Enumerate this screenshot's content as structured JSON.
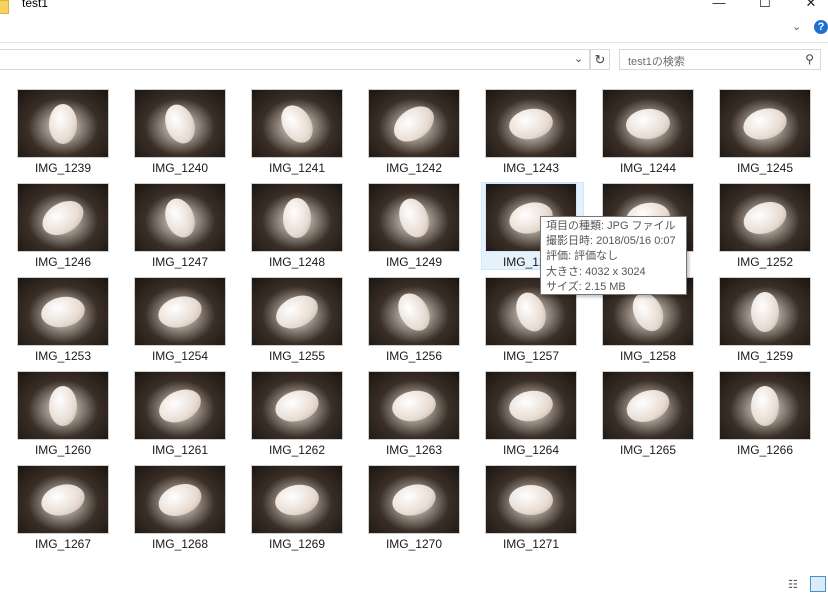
{
  "window": {
    "title": "test1",
    "minimize_glyph": "—",
    "maximize_glyph": "☐",
    "close_glyph": "✕"
  },
  "ribbon": {
    "expand_glyph": "⌄",
    "help_glyph": "?"
  },
  "address": {
    "dropdown_glyph": "⌄",
    "refresh_glyph": "↻"
  },
  "search": {
    "placeholder": "test1の検索",
    "icon": "search-icon",
    "icon_glyph": "⚲"
  },
  "files": [
    "IMG_1239",
    "IMG_1240",
    "IMG_1241",
    "IMG_1242",
    "IMG_1243",
    "IMG_1244",
    "IMG_1245",
    "IMG_1246",
    "IMG_1247",
    "IMG_1248",
    "IMG_1249",
    "IMG_1250",
    "IMG_1251",
    "IMG_1252",
    "IMG_1253",
    "IMG_1254",
    "IMG_1255",
    "IMG_1256",
    "IMG_1257",
    "IMG_1258",
    "IMG_1259",
    "IMG_1260",
    "IMG_1261",
    "IMG_1262",
    "IMG_1263",
    "IMG_1264",
    "IMG_1265",
    "IMG_1266",
    "IMG_1267",
    "IMG_1268",
    "IMG_1269",
    "IMG_1270",
    "IMG_1271"
  ],
  "selected_file": "IMG_1250",
  "tooltip": {
    "type": "項目の種類: JPG ファイル",
    "date": "撮影日時: 2018/05/16 0:07",
    "rating": "評価: 評価なし",
    "dimensions": "大きさ: 4032 x 3024",
    "size": "サイズ: 2.15 MB"
  },
  "status_bar": {
    "details_view_glyph": "☷"
  },
  "colors": {
    "selection": "#e5f1fb",
    "help_blue": "#1e6fd1",
    "folder_yellow": "#f4d35e"
  }
}
